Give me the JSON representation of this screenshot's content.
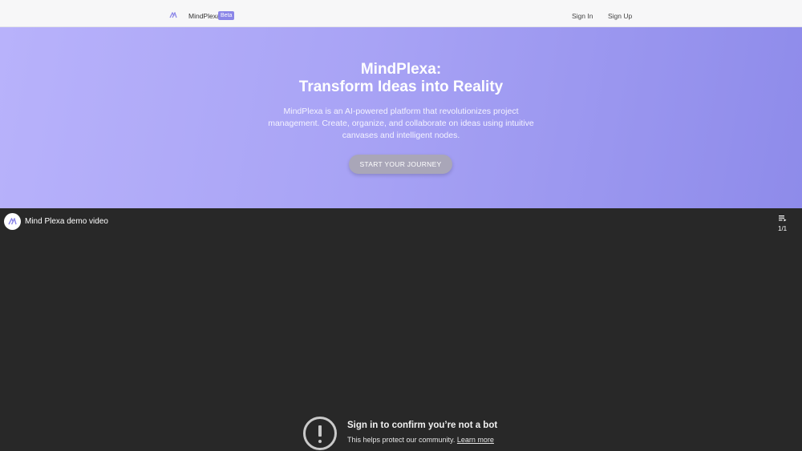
{
  "header": {
    "logo_icon": "mindplexa-logo-icon",
    "brand": "MindPlexa",
    "beta_badge": "Beta",
    "sign_in": "Sign In",
    "sign_up": "Sign Up"
  },
  "hero": {
    "title_line1": "MindPlexa:",
    "title_line2": "Transform Ideas into Reality",
    "description": "MindPlexa is an AI-powered platform that revolutionizes project management. Create, organize, and collaborate on ideas using intuitive canvases and intelligent nodes.",
    "cta": "START YOUR JOURNEY"
  },
  "video": {
    "channel_icon": "mindplexa-logo-icon",
    "title": "Mind Plexa demo video",
    "playlist_icon": "playlist-icon",
    "playlist_count": "1/1",
    "warning_icon": "exclamation-circle-icon",
    "bot_title": "Sign in to confirm you’re not a bot",
    "bot_subtitle": "This helps protect our community.",
    "learn_more": "Learn more"
  },
  "colors": {
    "hero_gradient_start": "#b8b2fb",
    "hero_gradient_end": "#8e8bea",
    "beta_badge": "#8b86e8",
    "cta_button": "#a9a6b8",
    "video_background": "#282828"
  }
}
